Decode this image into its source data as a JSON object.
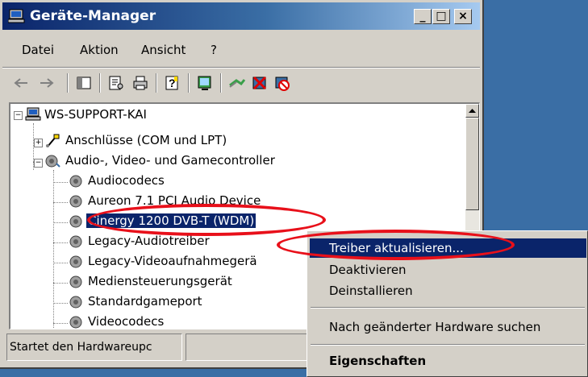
{
  "window": {
    "title": "Geräte-Manager",
    "controls": {
      "minimize": "_",
      "maximize": "□",
      "close": "×"
    }
  },
  "menu": [
    "Datei",
    "Aktion",
    "Ansicht",
    "?"
  ],
  "toolbar": [
    "back-arrow-icon",
    "forward-arrow-icon",
    "console-tree-icon",
    "properties-icon",
    "print-icon",
    "help-icon",
    "scan-hardware-icon",
    "update-driver-icon",
    "uninstall-icon",
    "disable-icon"
  ],
  "tree": {
    "root": "WS-SUPPORT-KAI",
    "categories": [
      {
        "label": "Anschlüsse (COM und LPT)",
        "expanded": false
      },
      {
        "label": "Audio-, Video- und Gamecontroller",
        "expanded": true
      }
    ],
    "devices": [
      "Audiocodecs",
      "Aureon 7.1 PCI Audio Device",
      "Cinergy 1200 DVB-T (WDM)",
      "Legacy-Audiotreiber",
      "Legacy-Videoaufnahmegerä",
      "Mediensteuerungsgerät",
      "Standardgameport",
      "Videocodecs"
    ],
    "selected_device": "Cinergy 1200 DVB-T (WDM)"
  },
  "status": {
    "text": "Startet den Hardwareupc"
  },
  "context_menu": {
    "items": [
      "Treiber aktualisieren...",
      "Deaktivieren",
      "Deinstallieren",
      "Nach geänderter Hardware suchen",
      "Eigenschaften"
    ],
    "highlighted": "Treiber aktualisieren..."
  },
  "colors": {
    "desktop": "#3a6ea5",
    "title_gradient_start": "#0a246a",
    "selection": "#0a246a",
    "annotation_ellipse": "#e8101a"
  }
}
